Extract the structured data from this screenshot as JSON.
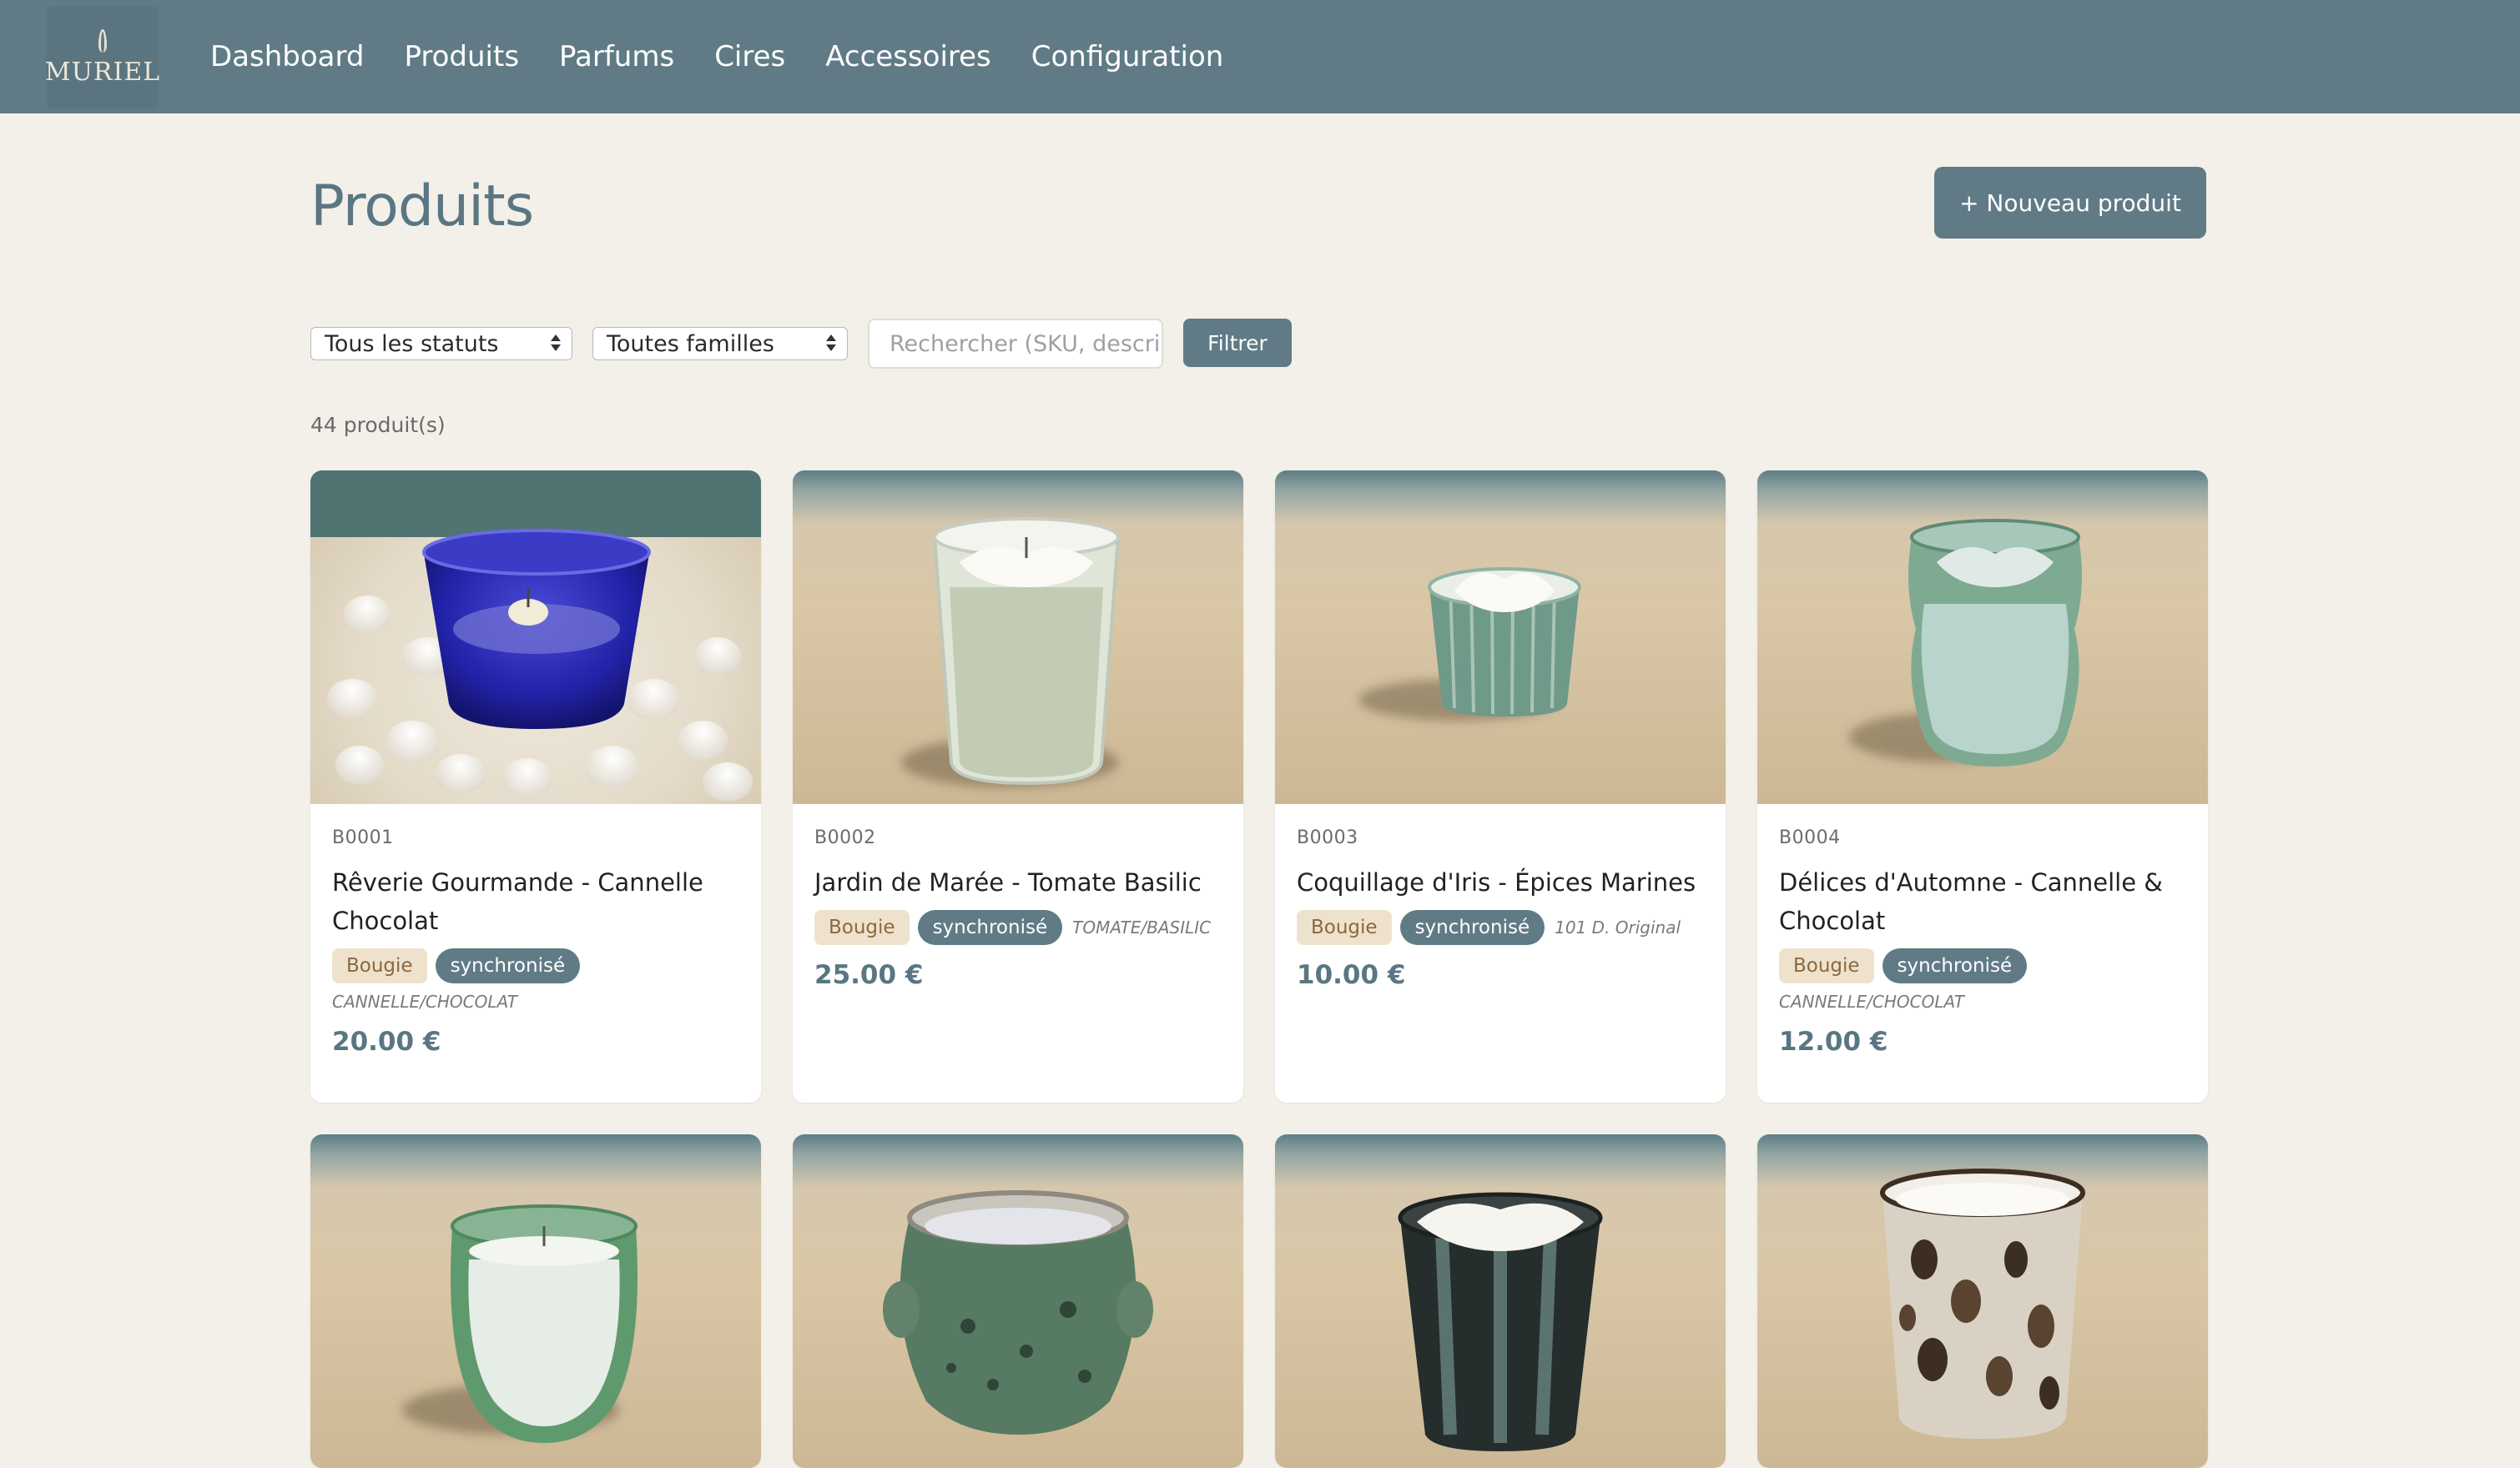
{
  "brand": {
    "logo_text": "MURIEL"
  },
  "nav": {
    "items": [
      "Dashboard",
      "Produits",
      "Parfums",
      "Cires",
      "Accessoires",
      "Configuration"
    ]
  },
  "page": {
    "title": "Produits",
    "new_button": "+ Nouveau produit",
    "count": "44 produit(s)"
  },
  "filters": {
    "status_value": "Tous les statuts",
    "family_value": "Toutes familles",
    "search_placeholder": "Rechercher (SKU, descrip",
    "filter_button": "Filtrer"
  },
  "products": [
    {
      "sku": "B0001",
      "name": "Rêverie Gourmande - Cannelle Chocolat",
      "family": "Bougie",
      "status": "synchronisé",
      "note": "CANNELLE/CHOCOLAT",
      "price": "20.00 €"
    },
    {
      "sku": "B0002",
      "name": "Jardin de Marée - Tomate Basilic",
      "family": "Bougie",
      "status": "synchronisé",
      "note": "TOMATE/BASILIC",
      "price": "25.00 €"
    },
    {
      "sku": "B0003",
      "name": "Coquillage d'Iris - Épices Marines",
      "family": "Bougie",
      "status": "synchronisé",
      "note": "101 D. Original",
      "price": "10.00 €"
    },
    {
      "sku": "B0004",
      "name": "Délices d'Automne - Cannelle & Chocolat",
      "family": "Bougie",
      "status": "synchronisé",
      "note": "CANNELLE/CHOCOLAT",
      "price": "12.00 €"
    }
  ],
  "colors": {
    "accent": "#607b86",
    "background": "#f3f0e9",
    "family_tag_bg": "#efe2cc",
    "family_tag_text": "#8a6840"
  }
}
